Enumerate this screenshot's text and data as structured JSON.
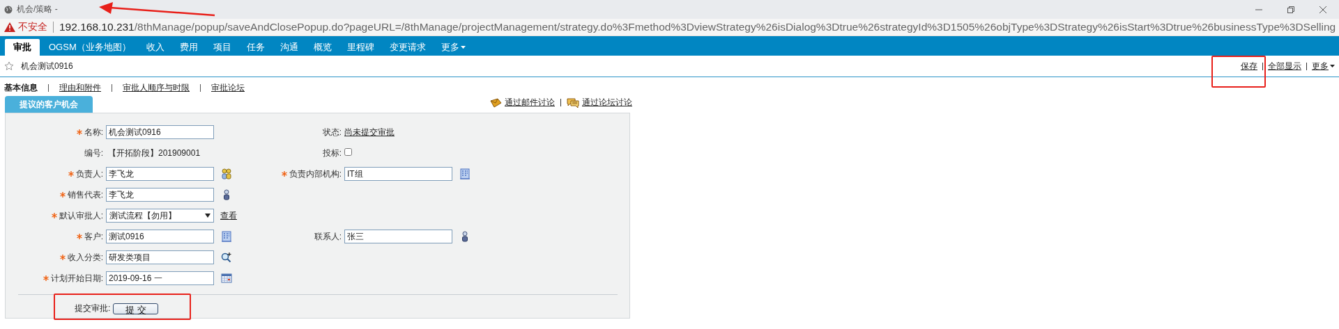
{
  "window": {
    "title": "机会/策略 -"
  },
  "address_bar": {
    "security_label": "不安全",
    "host": "192.168.10.231",
    "path": "/8thManage/popup/saveAndClosePopup.do?pageURL=/8thManage/projectManagement/strategy.do%3Fmethod%3DviewStrategy%26isDialog%3Dtrue%26strategyId%3D1505%26objType%3DStrategy%26isStart%3Dtrue%26businessType%3DSelling"
  },
  "nav_tabs": [
    {
      "label": "审批",
      "selected": true,
      "has_menu": false
    },
    {
      "label": "OGSM（业务地图）",
      "selected": false,
      "has_menu": false
    },
    {
      "label": "收入",
      "selected": false,
      "has_menu": false
    },
    {
      "label": "费用",
      "selected": false,
      "has_menu": false
    },
    {
      "label": "项目",
      "selected": false,
      "has_menu": false
    },
    {
      "label": "任务",
      "selected": false,
      "has_menu": false
    },
    {
      "label": "沟通",
      "selected": false,
      "has_menu": false
    },
    {
      "label": "概览",
      "selected": false,
      "has_menu": false
    },
    {
      "label": "里程碑",
      "selected": false,
      "has_menu": false
    },
    {
      "label": "变更请求",
      "selected": false,
      "has_menu": false
    },
    {
      "label": "更多",
      "selected": false,
      "has_menu": true
    }
  ],
  "record": {
    "title": "机会测试0916"
  },
  "actions": [
    {
      "label": "保存",
      "has_menu": false
    },
    {
      "label": "全部显示",
      "has_menu": false
    },
    {
      "label": "更多",
      "has_menu": true
    }
  ],
  "section_tabs": [
    {
      "label": "基本信息",
      "selected": true
    },
    {
      "label": "理由和附件",
      "selected": false
    },
    {
      "label": "审批人顺序与时限",
      "selected": false
    },
    {
      "label": "审批论坛",
      "selected": false
    }
  ],
  "panel": {
    "title": "提议的客户机会",
    "discuss_links": [
      {
        "label": "通过邮件讨论",
        "kind": "mail"
      },
      {
        "label": "通过论坛讨论",
        "kind": "forum"
      }
    ],
    "rows": [
      {
        "left": {
          "label": "名称:",
          "required": true,
          "kind": "text",
          "value": "机会测试0916"
        },
        "right": {
          "label": "状态:",
          "required": false,
          "kind": "link",
          "value": "尚未提交审批"
        }
      },
      {
        "left": {
          "label": "编号:",
          "required": false,
          "kind": "static",
          "value": "【开拓阶段】201909001"
        },
        "right": {
          "label": "投标:",
          "required": false,
          "kind": "checkbox",
          "checked": false
        }
      },
      {
        "left": {
          "label": "负责人:",
          "required": true,
          "kind": "text",
          "value": "李飞龙",
          "button": {
            "kind": "people"
          }
        },
        "right": {
          "label": "负责内部机构:",
          "required": true,
          "kind": "text",
          "value": "IT组",
          "button": {
            "kind": "building"
          }
        }
      },
      {
        "left": {
          "label": "销售代表:",
          "required": true,
          "kind": "text",
          "value": "李飞龙",
          "button": {
            "kind": "person"
          }
        }
      },
      {
        "left": {
          "label": "默认审批人:",
          "required": true,
          "kind": "select",
          "value": "测试流程【勿用】",
          "link": "查看"
        }
      },
      {
        "left": {
          "label": "客户:",
          "required": true,
          "kind": "text",
          "value": "测试0916",
          "button": {
            "kind": "building"
          }
        },
        "right": {
          "label": "联系人:",
          "required": false,
          "kind": "text",
          "value": "张三",
          "button": {
            "kind": "person"
          }
        }
      },
      {
        "left": {
          "label": "收入分类:",
          "required": true,
          "kind": "text",
          "value": "研发类项目",
          "button": {
            "kind": "search"
          }
        }
      },
      {
        "left": {
          "label": "计划开始日期:",
          "required": true,
          "kind": "text",
          "value": "2019-09-16 一",
          "button": {
            "kind": "calendar"
          }
        }
      }
    ],
    "submit": {
      "label": "提交审批:",
      "button": "提 交"
    }
  }
}
